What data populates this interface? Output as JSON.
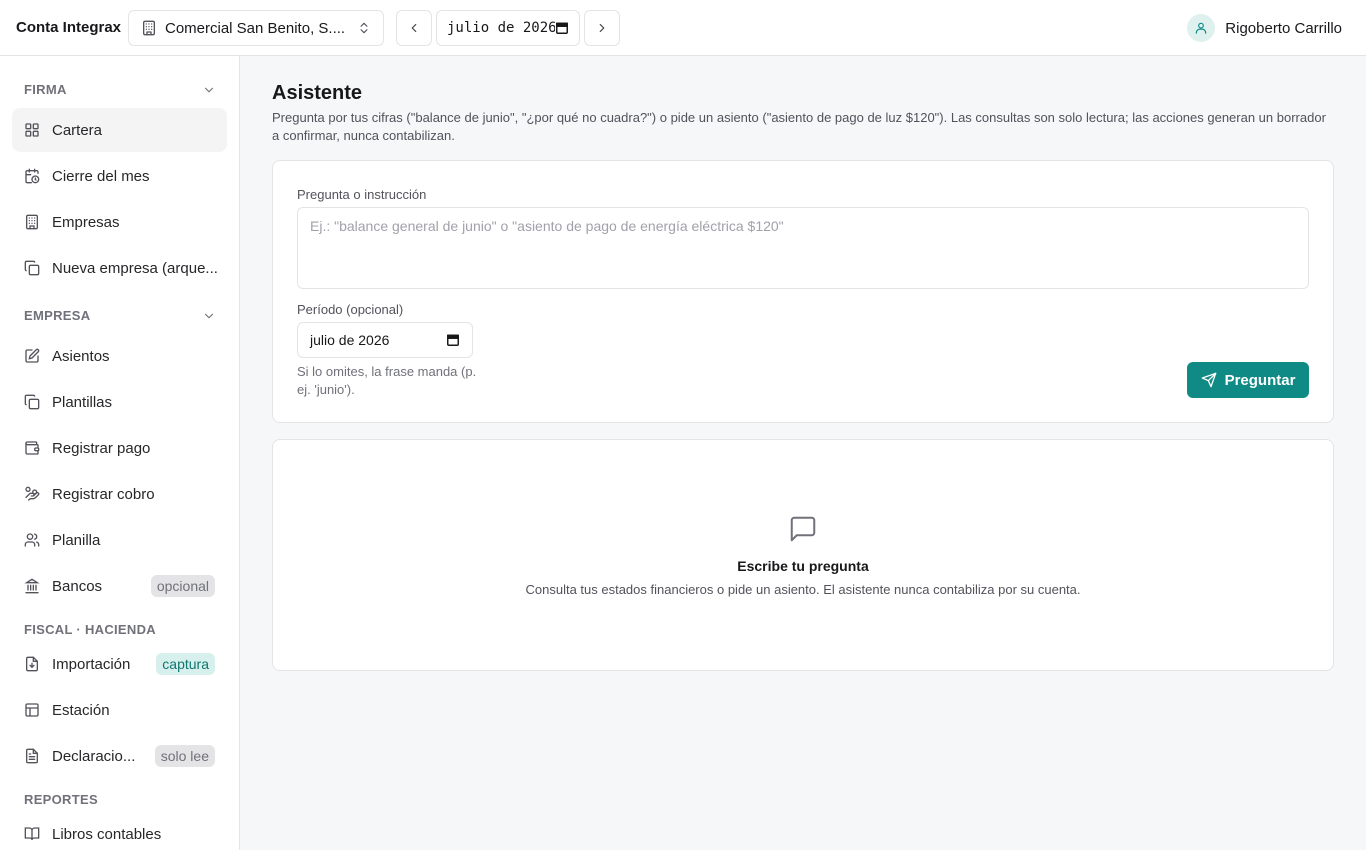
{
  "brand": "Conta Integrax",
  "company": {
    "name": "Comercial San Benito, S...."
  },
  "period_nav": {
    "value": "julio de 2026"
  },
  "user": {
    "name": "Rigoberto Carrillo"
  },
  "sidebar": {
    "sections": [
      {
        "title": "FIRMA",
        "items": [
          {
            "label": "Cartera",
            "icon": "grid-icon",
            "active": true
          },
          {
            "label": "Cierre del mes",
            "icon": "calendar-clock-icon"
          },
          {
            "label": "Empresas",
            "icon": "building-icon"
          },
          {
            "label": "Nueva empresa (arque...",
            "icon": "copy-icon"
          }
        ]
      },
      {
        "title": "EMPRESA",
        "items": [
          {
            "label": "Asientos",
            "icon": "edit-icon"
          },
          {
            "label": "Plantillas",
            "icon": "copy-icon"
          },
          {
            "label": "Registrar pago",
            "icon": "wallet-icon"
          },
          {
            "label": "Registrar cobro",
            "icon": "hand-coins-icon"
          },
          {
            "label": "Planilla",
            "icon": "users-icon"
          },
          {
            "label": "Bancos",
            "icon": "bank-icon",
            "badge": "opcional"
          }
        ]
      },
      {
        "title": "FISCAL · HACIENDA",
        "items": [
          {
            "label": "Importación",
            "icon": "file-import-icon",
            "badge": "captura"
          },
          {
            "label": "Estación",
            "icon": "table-icon"
          },
          {
            "label": "Declaracio...",
            "icon": "file-text-icon",
            "badge": "solo lee"
          }
        ]
      },
      {
        "title": "REPORTES",
        "items": [
          {
            "label": "Libros contables",
            "icon": "book-icon"
          }
        ]
      }
    ]
  },
  "main": {
    "title": "Asistente",
    "subtitle": "Pregunta por tus cifras (\"balance de junio\", \"¿por qué no cuadra?\") o pide un asiento (\"asiento de pago de luz $120\"). Las consultas son solo lectura; las acciones generan un borrador a confirmar, nunca contabilizan.",
    "form": {
      "question_label": "Pregunta o instrucción",
      "question_placeholder": "Ej.: \"balance general de junio\" o \"asiento de pago de energía eléctrica $120\"",
      "period_label": "Período (opcional)",
      "period_value": "julio de 2026",
      "period_hint": "Si lo omites, la frase manda (p. ej. 'junio').",
      "submit_label": "Preguntar"
    },
    "empty": {
      "title": "Escribe tu pregunta",
      "subtitle": "Consulta tus estados financieros o pide un asiento. El asistente nunca contabiliza por su cuenta."
    }
  },
  "colors": {
    "accent": "#0f8a84",
    "accent_soft": "#d7f0ee"
  }
}
